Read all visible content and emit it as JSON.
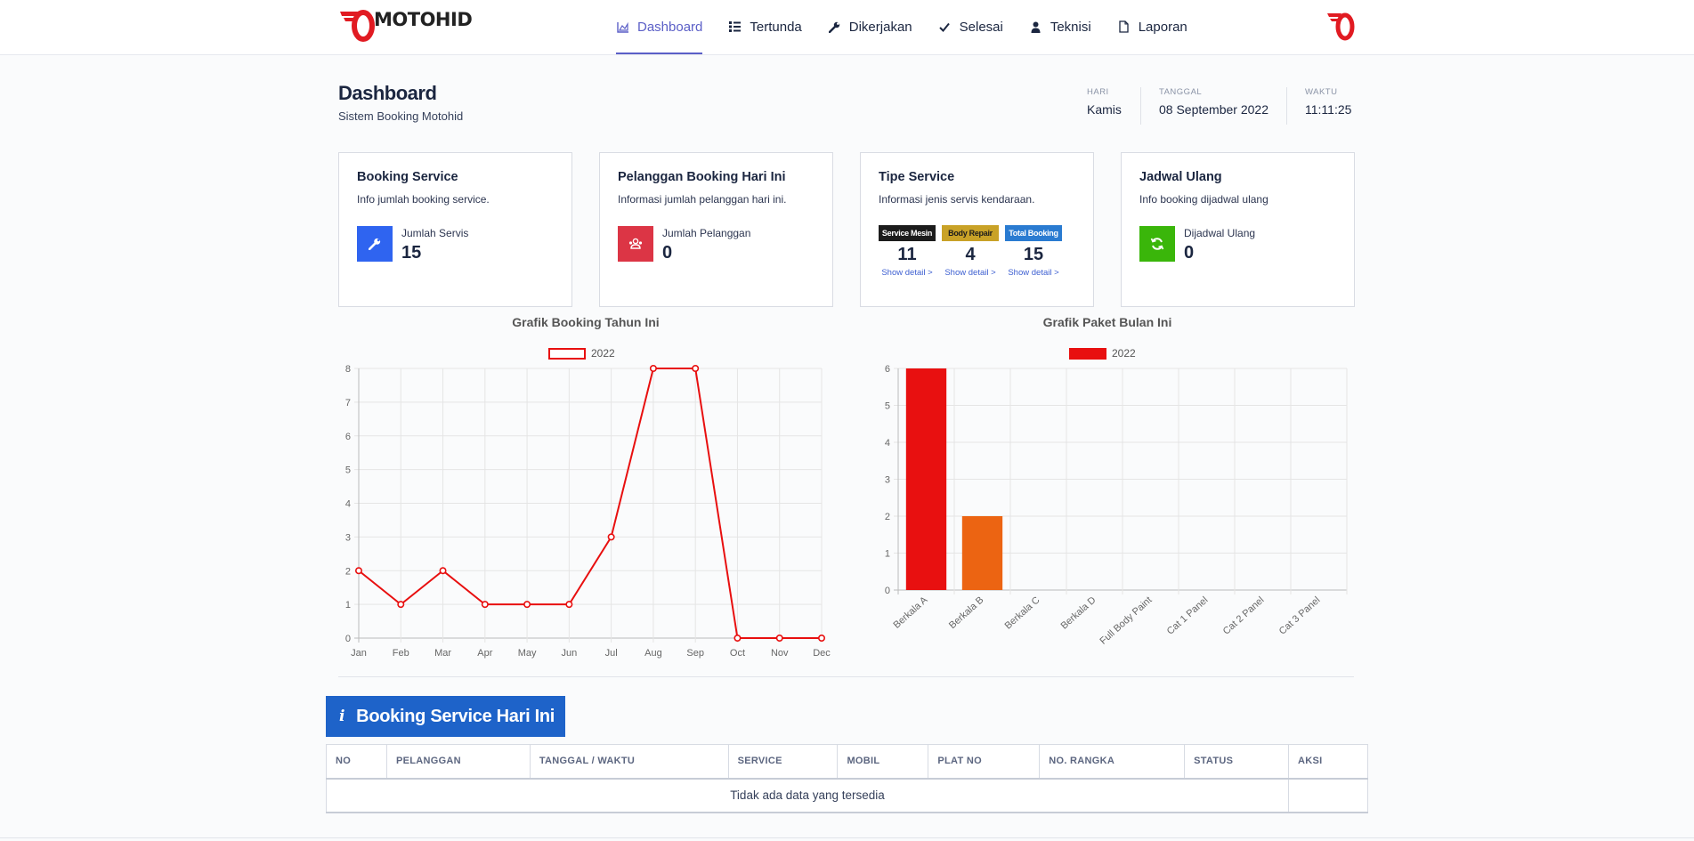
{
  "brand": {
    "name": "MOTOHID",
    "color": "#e11b22"
  },
  "nav": {
    "items": [
      {
        "label": "Dashboard",
        "icon": "chart-area-icon",
        "active": true
      },
      {
        "label": "Tertunda",
        "icon": "list-icon"
      },
      {
        "label": "Dikerjakan",
        "icon": "wrench-icon"
      },
      {
        "label": "Selesai",
        "icon": "check-icon"
      },
      {
        "label": "Teknisi",
        "icon": "user-icon"
      },
      {
        "label": "Laporan",
        "icon": "file-icon"
      }
    ]
  },
  "header": {
    "title": "Dashboard",
    "subtitle": "Sistem Booking Motohid",
    "day_label": "HARI",
    "day": "Kamis",
    "date_label": "TANGGAL",
    "date": "08 September 2022",
    "time_label": "WAKTU",
    "time": "11:11:25"
  },
  "cards": {
    "booking": {
      "title": "Booking Service",
      "desc": "Info jumlah booking service.",
      "stat_label": "Jumlah Servis",
      "stat_value": "15",
      "icon": "wrench-icon",
      "color": "#2f64f0"
    },
    "pelanggan": {
      "title": "Pelanggan Booking Hari Ini",
      "desc": "Informasi jumlah pelanggan hari ini.",
      "stat_label": "Jumlah Pelanggan",
      "stat_value": "0",
      "icon": "users-icon",
      "color": "#dc3545"
    },
    "tipe": {
      "title": "Tipe Service",
      "desc": "Informasi jenis servis kendaraan.",
      "types": [
        {
          "badge": "Service Mesin",
          "value": "11",
          "link": "Show detail >",
          "bg": "#1c1c1c",
          "fg": "#ffffff"
        },
        {
          "badge": "Body Repair",
          "value": "4",
          "link": "Show detail >",
          "bg": "#c9a227",
          "fg": "#1c1c1c"
        },
        {
          "badge": "Total Booking",
          "value": "15",
          "link": "Show detail >",
          "bg": "#2a7bd1",
          "fg": "#ffffff"
        }
      ]
    },
    "jadwal": {
      "title": "Jadwal Ulang",
      "desc": "Info booking dijadwal ulang",
      "stat_label": "Dijadwal Ulang",
      "stat_value": "0",
      "icon": "refresh-icon",
      "color": "#3ab60a"
    }
  },
  "chart_data": [
    {
      "type": "line",
      "title": "Grafik Booking Tahun Ini",
      "categories": [
        "Jan",
        "Feb",
        "Mar",
        "Apr",
        "May",
        "Jun",
        "Jul",
        "Aug",
        "Sep",
        "Oct",
        "Nov",
        "Dec"
      ],
      "series": [
        {
          "name": "2022",
          "values": [
            2,
            1,
            2,
            1,
            1,
            1,
            3,
            8,
            8,
            0,
            0,
            0
          ]
        }
      ],
      "ylim": [
        0,
        8
      ],
      "yticks": [
        "0",
        "1",
        "2",
        "3",
        "4",
        "5",
        "6",
        "7",
        "8"
      ],
      "grid": true,
      "legend": "top-center",
      "color": "#e80f0f"
    },
    {
      "type": "bar",
      "title": "Grafik Paket Bulan Ini",
      "categories": [
        "Berkala A",
        "Berkala B",
        "Berkala C",
        "Berkala D",
        "Full Body Paint",
        "Cat 1 Panel",
        "Cat 2 Panel",
        "Cat 3 Panel"
      ],
      "series": [
        {
          "name": "2022",
          "values": [
            6,
            2,
            0,
            0,
            0,
            0,
            0,
            0
          ]
        }
      ],
      "bar_colors": [
        "#e81010",
        "#ec6412",
        "#e81010",
        "#e81010",
        "#e81010",
        "#e81010",
        "#e81010",
        "#e81010"
      ],
      "ylim": [
        0,
        6
      ],
      "yticks": [
        "0",
        "1",
        "2",
        "3",
        "4",
        "5",
        "6"
      ],
      "grid": true,
      "legend": "top-center",
      "color": "#e81010"
    }
  ],
  "table": {
    "heading": "Booking Service Hari Ini",
    "heading_icon": "info-icon",
    "columns": [
      "NO",
      "PELANGGAN",
      "TANGGAL / WAKTU",
      "SERVICE",
      "MOBIL",
      "PLAT NO",
      "NO. RANGKA",
      "STATUS",
      "AKSI"
    ],
    "empty_text": "Tidak ada data yang tersedia"
  }
}
